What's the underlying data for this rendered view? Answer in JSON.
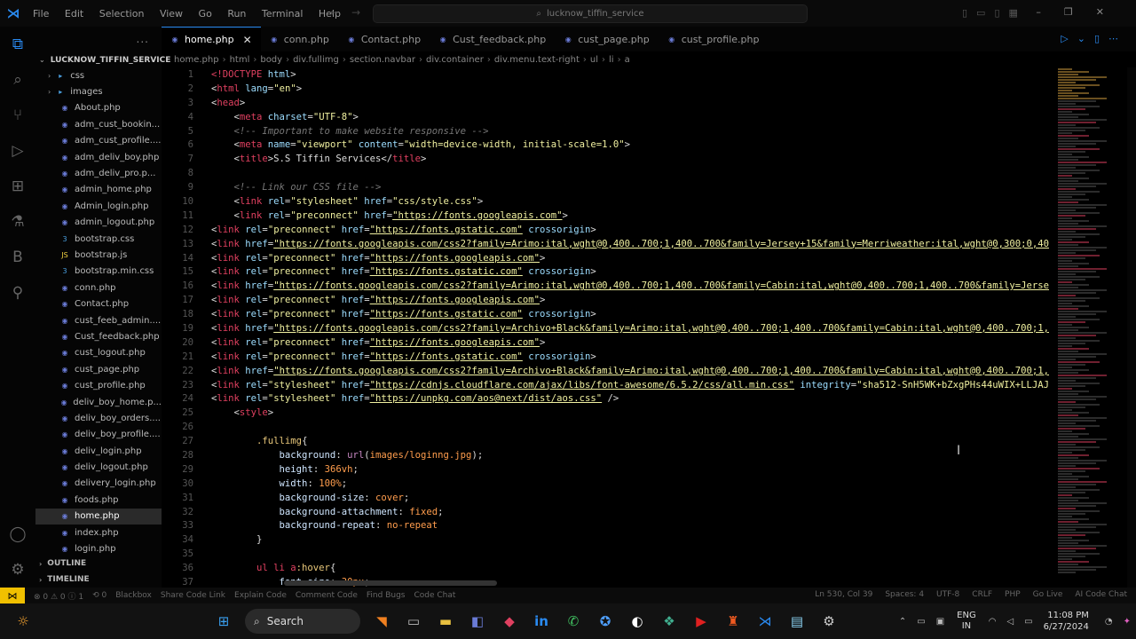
{
  "titlebar": {
    "menu": [
      "File",
      "Edit",
      "Selection",
      "View",
      "Go",
      "Run",
      "Terminal",
      "Help"
    ],
    "search": "lucknow_tiffin_service"
  },
  "sidebar": {
    "header": "...",
    "project": "LUCKNOW_TIFFIN_SERVICE",
    "items": [
      {
        "label": "css",
        "kind": "folder"
      },
      {
        "label": "images",
        "kind": "folder"
      },
      {
        "label": "About.php",
        "kind": "php"
      },
      {
        "label": "adm_cust_bookin...",
        "kind": "php"
      },
      {
        "label": "adm_cust_profile....",
        "kind": "php"
      },
      {
        "label": "adm_deliv_boy.php",
        "kind": "php"
      },
      {
        "label": "adm_deliv_pro.p...",
        "kind": "php"
      },
      {
        "label": "admin_home.php",
        "kind": "php"
      },
      {
        "label": "Admin_login.php",
        "kind": "php"
      },
      {
        "label": "admin_logout.php",
        "kind": "php"
      },
      {
        "label": "bootstrap.css",
        "kind": "css"
      },
      {
        "label": "bootstrap.js",
        "kind": "js"
      },
      {
        "label": "bootstrap.min.css",
        "kind": "css"
      },
      {
        "label": "conn.php",
        "kind": "php"
      },
      {
        "label": "Contact.php",
        "kind": "php"
      },
      {
        "label": "cust_feeb_admin....",
        "kind": "php"
      },
      {
        "label": "Cust_feedback.php",
        "kind": "php"
      },
      {
        "label": "cust_logout.php",
        "kind": "php"
      },
      {
        "label": "cust_page.php",
        "kind": "php"
      },
      {
        "label": "cust_profile.php",
        "kind": "php"
      },
      {
        "label": "deliv_boy_home.p...",
        "kind": "php"
      },
      {
        "label": "deliv_boy_orders....",
        "kind": "php"
      },
      {
        "label": "deliv_boy_profile....",
        "kind": "php"
      },
      {
        "label": "deliv_login.php",
        "kind": "php"
      },
      {
        "label": "deliv_logout.php",
        "kind": "php"
      },
      {
        "label": "delivery_login.php",
        "kind": "php"
      },
      {
        "label": "foods.php",
        "kind": "php"
      },
      {
        "label": "home.php",
        "kind": "php",
        "active": true
      },
      {
        "label": "index.php",
        "kind": "php"
      },
      {
        "label": "login.php",
        "kind": "php"
      }
    ],
    "sections": [
      "OUTLINE",
      "TIMELINE"
    ]
  },
  "tabs": [
    "home.php",
    "conn.php",
    "Contact.php",
    "Cust_feedback.php",
    "cust_page.php",
    "cust_profile.php"
  ],
  "breadcrumb": [
    "home.php",
    "html",
    "body",
    "div.fullimg",
    "section.navbar",
    "div.container",
    "div.menu.text-right",
    "ul",
    "li",
    "a"
  ],
  "code_lines": [
    [
      [
        "t",
        "<!DOCTYPE "
      ],
      [
        "a",
        "html"
      ],
      [
        "p",
        ">"
      ]
    ],
    [
      [
        "p",
        "<"
      ],
      [
        "t",
        "html "
      ],
      [
        "a",
        "lang"
      ],
      [
        "p",
        "="
      ],
      [
        "s",
        "\"en\""
      ],
      [
        "p",
        ">"
      ]
    ],
    [
      [
        "p",
        "<"
      ],
      [
        "t",
        "head"
      ],
      [
        "p",
        ">"
      ]
    ],
    [
      [
        "p",
        "    <"
      ],
      [
        "t",
        "meta "
      ],
      [
        "a",
        "charset"
      ],
      [
        "p",
        "="
      ],
      [
        "s",
        "\"UTF-8\""
      ],
      [
        "p",
        ">"
      ]
    ],
    [
      [
        "c",
        "    <!-- Important to make website responsive -->"
      ]
    ],
    [
      [
        "p",
        "    <"
      ],
      [
        "t",
        "meta "
      ],
      [
        "a",
        "name"
      ],
      [
        "p",
        "="
      ],
      [
        "s",
        "\"viewport\" "
      ],
      [
        "a",
        "content"
      ],
      [
        "p",
        "="
      ],
      [
        "s",
        "\"width=device-width, initial-scale=1.0\""
      ],
      [
        "p",
        ">"
      ]
    ],
    [
      [
        "p",
        "    <"
      ],
      [
        "t",
        "title"
      ],
      [
        "p",
        ">S.S Tiffin Services</"
      ],
      [
        "t",
        "title"
      ],
      [
        "p",
        ">"
      ]
    ],
    [
      [
        "p",
        ""
      ]
    ],
    [
      [
        "c",
        "    <!-- Link our CSS file -->"
      ]
    ],
    [
      [
        "p",
        "    <"
      ],
      [
        "t",
        "link "
      ],
      [
        "a",
        "rel"
      ],
      [
        "p",
        "="
      ],
      [
        "s",
        "\"stylesheet\" "
      ],
      [
        "a",
        "href"
      ],
      [
        "p",
        "="
      ],
      [
        "s",
        "\"css/style.css\""
      ],
      [
        "p",
        ">"
      ]
    ],
    [
      [
        "p",
        "    <"
      ],
      [
        "t",
        "link "
      ],
      [
        "a",
        "rel"
      ],
      [
        "p",
        "="
      ],
      [
        "s",
        "\"preconnect\" "
      ],
      [
        "a",
        "href"
      ],
      [
        "p",
        "="
      ],
      [
        "u",
        "\"https://fonts.googleapis.com\""
      ],
      [
        "p",
        ">"
      ]
    ],
    [
      [
        "p",
        "<"
      ],
      [
        "t",
        "link "
      ],
      [
        "a",
        "rel"
      ],
      [
        "p",
        "="
      ],
      [
        "s",
        "\"preconnect\" "
      ],
      [
        "a",
        "href"
      ],
      [
        "p",
        "="
      ],
      [
        "u",
        "\"https://fonts.gstatic.com\""
      ],
      [
        "a",
        " crossorigin"
      ],
      [
        "p",
        ">"
      ]
    ],
    [
      [
        "p",
        "<"
      ],
      [
        "t",
        "link "
      ],
      [
        "a",
        "href"
      ],
      [
        "p",
        "="
      ],
      [
        "u",
        "\"https://fonts.googleapis.com/css2?family=Arimo:ital,wght@0,400..700;1,400..700&family=Jersey+15&family=Merriweather:ital,wght@0,300;0,40"
      ]
    ],
    [
      [
        "p",
        "<"
      ],
      [
        "t",
        "link "
      ],
      [
        "a",
        "rel"
      ],
      [
        "p",
        "="
      ],
      [
        "s",
        "\"preconnect\" "
      ],
      [
        "a",
        "href"
      ],
      [
        "p",
        "="
      ],
      [
        "u",
        "\"https://fonts.googleapis.com\""
      ],
      [
        "p",
        ">"
      ]
    ],
    [
      [
        "p",
        "<"
      ],
      [
        "t",
        "link "
      ],
      [
        "a",
        "rel"
      ],
      [
        "p",
        "="
      ],
      [
        "s",
        "\"preconnect\" "
      ],
      [
        "a",
        "href"
      ],
      [
        "p",
        "="
      ],
      [
        "u",
        "\"https://fonts.gstatic.com\""
      ],
      [
        "a",
        " crossorigin"
      ],
      [
        "p",
        ">"
      ]
    ],
    [
      [
        "p",
        "<"
      ],
      [
        "t",
        "link "
      ],
      [
        "a",
        "href"
      ],
      [
        "p",
        "="
      ],
      [
        "u",
        "\"https://fonts.googleapis.com/css2?family=Arimo:ital,wght@0,400..700;1,400..700&family=Cabin:ital,wght@0,400..700;1,400..700&family=Jerse"
      ]
    ],
    [
      [
        "p",
        "<"
      ],
      [
        "t",
        "link "
      ],
      [
        "a",
        "rel"
      ],
      [
        "p",
        "="
      ],
      [
        "s",
        "\"preconnect\" "
      ],
      [
        "a",
        "href"
      ],
      [
        "p",
        "="
      ],
      [
        "u",
        "\"https://fonts.googleapis.com\""
      ],
      [
        "p",
        ">"
      ]
    ],
    [
      [
        "p",
        "<"
      ],
      [
        "t",
        "link "
      ],
      [
        "a",
        "rel"
      ],
      [
        "p",
        "="
      ],
      [
        "s",
        "\"preconnect\" "
      ],
      [
        "a",
        "href"
      ],
      [
        "p",
        "="
      ],
      [
        "u",
        "\"https://fonts.gstatic.com\""
      ],
      [
        "a",
        " crossorigin"
      ],
      [
        "p",
        ">"
      ]
    ],
    [
      [
        "p",
        "<"
      ],
      [
        "t",
        "link "
      ],
      [
        "a",
        "href"
      ],
      [
        "p",
        "="
      ],
      [
        "u",
        "\"https://fonts.googleapis.com/css2?family=Archivo+Black&family=Arimo:ital,wght@0,400..700;1,400..700&family=Cabin:ital,wght@0,400..700;1,"
      ]
    ],
    [
      [
        "p",
        "<"
      ],
      [
        "t",
        "link "
      ],
      [
        "a",
        "rel"
      ],
      [
        "p",
        "="
      ],
      [
        "s",
        "\"preconnect\" "
      ],
      [
        "a",
        "href"
      ],
      [
        "p",
        "="
      ],
      [
        "u",
        "\"https://fonts.googleapis.com\""
      ],
      [
        "p",
        ">"
      ]
    ],
    [
      [
        "p",
        "<"
      ],
      [
        "t",
        "link "
      ],
      [
        "a",
        "rel"
      ],
      [
        "p",
        "="
      ],
      [
        "s",
        "\"preconnect\" "
      ],
      [
        "a",
        "href"
      ],
      [
        "p",
        "="
      ],
      [
        "u",
        "\"https://fonts.gstatic.com\""
      ],
      [
        "a",
        " crossorigin"
      ],
      [
        "p",
        ">"
      ]
    ],
    [
      [
        "p",
        "<"
      ],
      [
        "t",
        "link "
      ],
      [
        "a",
        "href"
      ],
      [
        "p",
        "="
      ],
      [
        "u",
        "\"https://fonts.googleapis.com/css2?family=Archivo+Black&family=Arimo:ital,wght@0,400..700;1,400..700&family=Cabin:ital,wght@0,400..700;1,"
      ]
    ],
    [
      [
        "p",
        "<"
      ],
      [
        "t",
        "link "
      ],
      [
        "a",
        "rel"
      ],
      [
        "p",
        "="
      ],
      [
        "s",
        "\"stylesheet\" "
      ],
      [
        "a",
        "href"
      ],
      [
        "p",
        "="
      ],
      [
        "u",
        "\"https://cdnjs.cloudflare.com/ajax/libs/font-awesome/6.5.2/css/all.min.css\""
      ],
      [
        "a",
        " integrity"
      ],
      [
        "p",
        "="
      ],
      [
        "s",
        "\"sha512-SnH5WK+bZxgPHs44uWIX+LLJAJ"
      ]
    ],
    [
      [
        "p",
        "<"
      ],
      [
        "t",
        "link "
      ],
      [
        "a",
        "rel"
      ],
      [
        "p",
        "="
      ],
      [
        "s",
        "\"stylesheet\" "
      ],
      [
        "a",
        "href"
      ],
      [
        "p",
        "="
      ],
      [
        "u",
        "\"https://unpkg.com/aos@next/dist/aos.css\""
      ],
      [
        "p",
        " />"
      ]
    ],
    [
      [
        "p",
        "    <"
      ],
      [
        "t",
        "style"
      ],
      [
        "p",
        ">"
      ]
    ],
    [
      [
        "p",
        ""
      ]
    ],
    [
      [
        "sel",
        "        .fullimg"
      ],
      [
        "p",
        "{"
      ]
    ],
    [
      [
        "prop",
        "            background"
      ],
      [
        "p",
        ": "
      ],
      [
        "kw",
        "url"
      ],
      [
        "p",
        "("
      ],
      [
        "v",
        "images/loginng.jpg"
      ],
      [
        "p",
        ");"
      ]
    ],
    [
      [
        "prop",
        "            height"
      ],
      [
        "p",
        ": "
      ],
      [
        "v",
        "366vh"
      ],
      [
        "p",
        ";"
      ]
    ],
    [
      [
        "prop",
        "            width"
      ],
      [
        "p",
        ": "
      ],
      [
        "v",
        "100%"
      ],
      [
        "p",
        ";"
      ]
    ],
    [
      [
        "prop",
        "            background-size"
      ],
      [
        "p",
        ": "
      ],
      [
        "v",
        "cover"
      ],
      [
        "p",
        ";"
      ]
    ],
    [
      [
        "prop",
        "            background-attachment"
      ],
      [
        "p",
        ": "
      ],
      [
        "v",
        "fixed"
      ],
      [
        "p",
        ";"
      ]
    ],
    [
      [
        "prop",
        "            background-repeat"
      ],
      [
        "p",
        ": "
      ],
      [
        "v",
        "no-repeat"
      ]
    ],
    [
      [
        "p",
        "        }"
      ]
    ],
    [
      [
        "p",
        ""
      ]
    ],
    [
      [
        "t",
        "        ul li a"
      ],
      [
        "sel",
        ":hover"
      ],
      [
        "p",
        "{"
      ]
    ],
    [
      [
        "prop",
        "            font-size"
      ],
      [
        "p",
        ": "
      ],
      [
        "v",
        "30px"
      ],
      [
        "p",
        ";"
      ]
    ]
  ],
  "status": {
    "left": [
      "⊗ 0 ⚠ 0 ⓘ 1",
      "⟲ 0",
      "Blackbox",
      "Share Code Link",
      "Explain Code",
      "Comment Code",
      "Find Bugs",
      "Code Chat"
    ],
    "right": [
      "Ln 530, Col 39",
      "Spaces: 4",
      "UTF-8",
      "CRLF",
      "PHP",
      "Go Live",
      "AI Code Chat"
    ]
  },
  "taskbar": {
    "search": "Search",
    "lang": [
      "ENG",
      "IN"
    ],
    "time": "11:08 PM",
    "date": "6/27/2024"
  }
}
